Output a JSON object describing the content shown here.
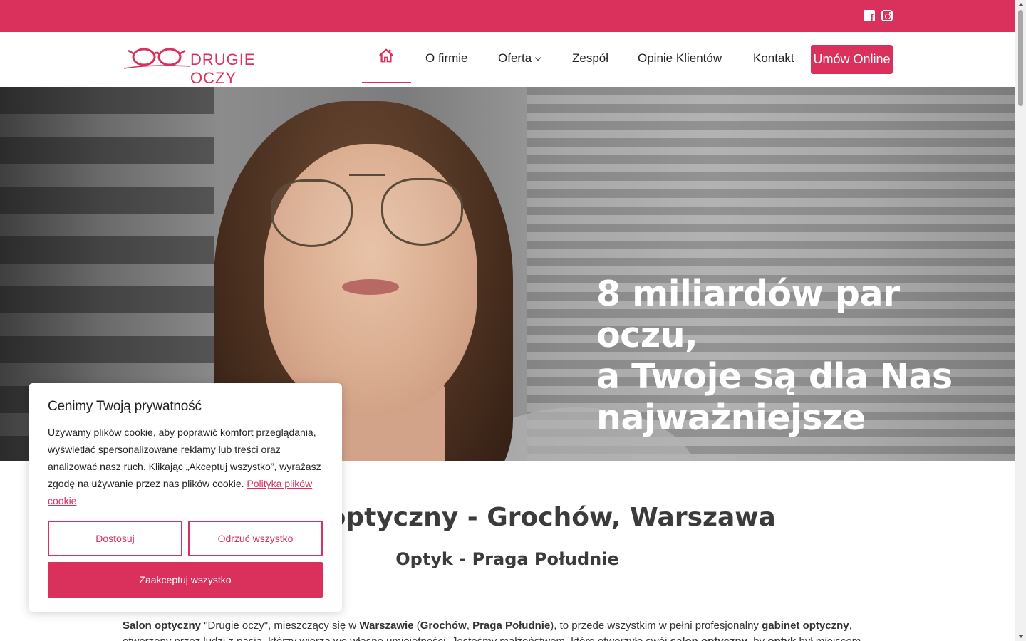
{
  "topbar": {
    "social": [
      {
        "icon": "facebook-icon"
      },
      {
        "icon": "instagram-icon"
      }
    ],
    "color": "#d9305c"
  },
  "header": {
    "logo_text": "DRUGIE OCZY",
    "nav": {
      "home_icon": "home-icon",
      "items": [
        "O firmie",
        "Oferta",
        "Zespół",
        "Opinie Klientów",
        "Kontakt"
      ]
    },
    "cta": "Umów Online"
  },
  "hero": {
    "title_line1": "8 miliardów par oczu,",
    "title_line2": "a Twoje są dla Nas",
    "title_line3": "najważniejsze"
  },
  "main": {
    "h1": "Salon optyczny - Grochów, Warszawa",
    "h2": "Optyk - Praga Południe",
    "paragraph": {
      "p1": "Salon optyczny",
      "p2": " \"Drugie oczy\", mieszczący się w ",
      "p3": "Warszawie",
      "p4": " (",
      "p5": "Grochów",
      "p6": ", ",
      "p7": "Praga Południe",
      "p8": "), to przede wszystkim w pełni profesjonalny ",
      "p9": "gabinet optyczny",
      "p10": ", otworzony przez ludzi z pasją, którzy wierzą we własne umiejętności. Jesteśmy małżeństwem, które otworzyło swój ",
      "p11": "salon optyczny",
      "p12": ", by ",
      "p13": "optyk",
      "p14": " był miejscem"
    }
  },
  "cookie": {
    "title": "Cenimy Twoją prywatność",
    "text": "Używamy plików cookie, aby poprawić komfort przeglądania, wyświetlać spersonalizowane reklamy lub treści oraz analizować nasz ruch. Klikając „Akceptuj wszystko”, wyrażasz zgodę na używanie przez nas plików cookie.",
    "link": "Polityka plików cookie",
    "customize": "Dostosuj",
    "reject": "Odrzuć wszystko",
    "accept": "Zaakceptuj wszystko"
  }
}
